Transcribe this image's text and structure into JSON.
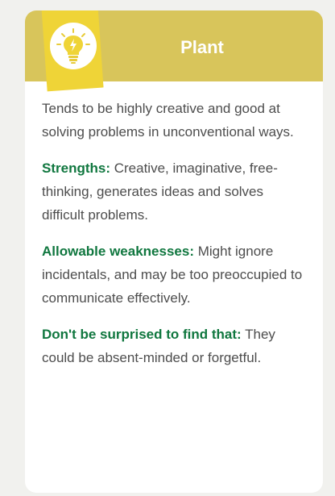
{
  "card": {
    "title": "Plant",
    "icon": "lightbulb-icon",
    "intro": "Tends to be highly creative and good at solving problems in unconventional ways.",
    "sections": [
      {
        "label": "Strengths:",
        "text": "Creative, imaginative, free-thinking, generates ideas and solves difficult problems."
      },
      {
        "label": "Allowable weaknesses:",
        "text": "Might ignore incidentals, and may be too preoccupied to communicate effectively."
      },
      {
        "label": "Don't be surprised to find that:",
        "text": "They could be absent-minded or forgetful."
      }
    ]
  },
  "colors": {
    "header_bg": "#d8c55b",
    "icon_tile": "#efd437",
    "label_green": "#10773f",
    "body_text": "#4d4d4d",
    "page_bg": "#f1f1ee"
  }
}
